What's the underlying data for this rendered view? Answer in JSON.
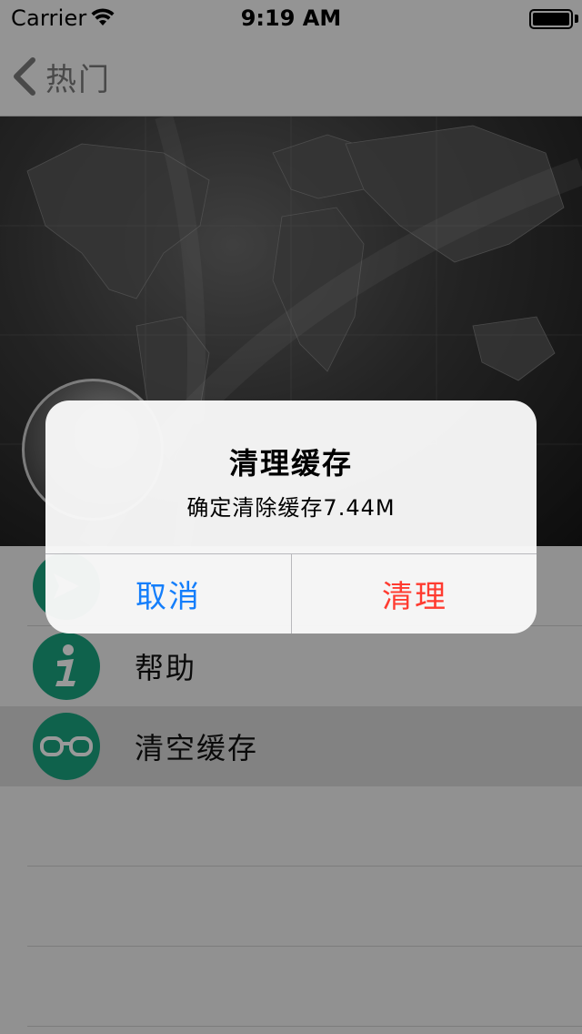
{
  "status_bar": {
    "carrier": "Carrier",
    "time": "9:19 AM",
    "battery_level": 1.0
  },
  "nav": {
    "back_label": "热门"
  },
  "colors": {
    "accent_green": "#1aa37f",
    "cancel_blue": "#147efb",
    "destructive_red": "#ff3b30"
  },
  "list": {
    "items": [
      {
        "label": "",
        "icon": "share-icon",
        "selected": false
      },
      {
        "label": "帮助",
        "icon": "info-icon",
        "selected": false
      },
      {
        "label": "清空缓存",
        "icon": "glasses-icon",
        "selected": true
      }
    ]
  },
  "alert": {
    "title": "清理缓存",
    "message": "确定清除缓存7.44M",
    "cancel_label": "取消",
    "confirm_label": "清理"
  }
}
